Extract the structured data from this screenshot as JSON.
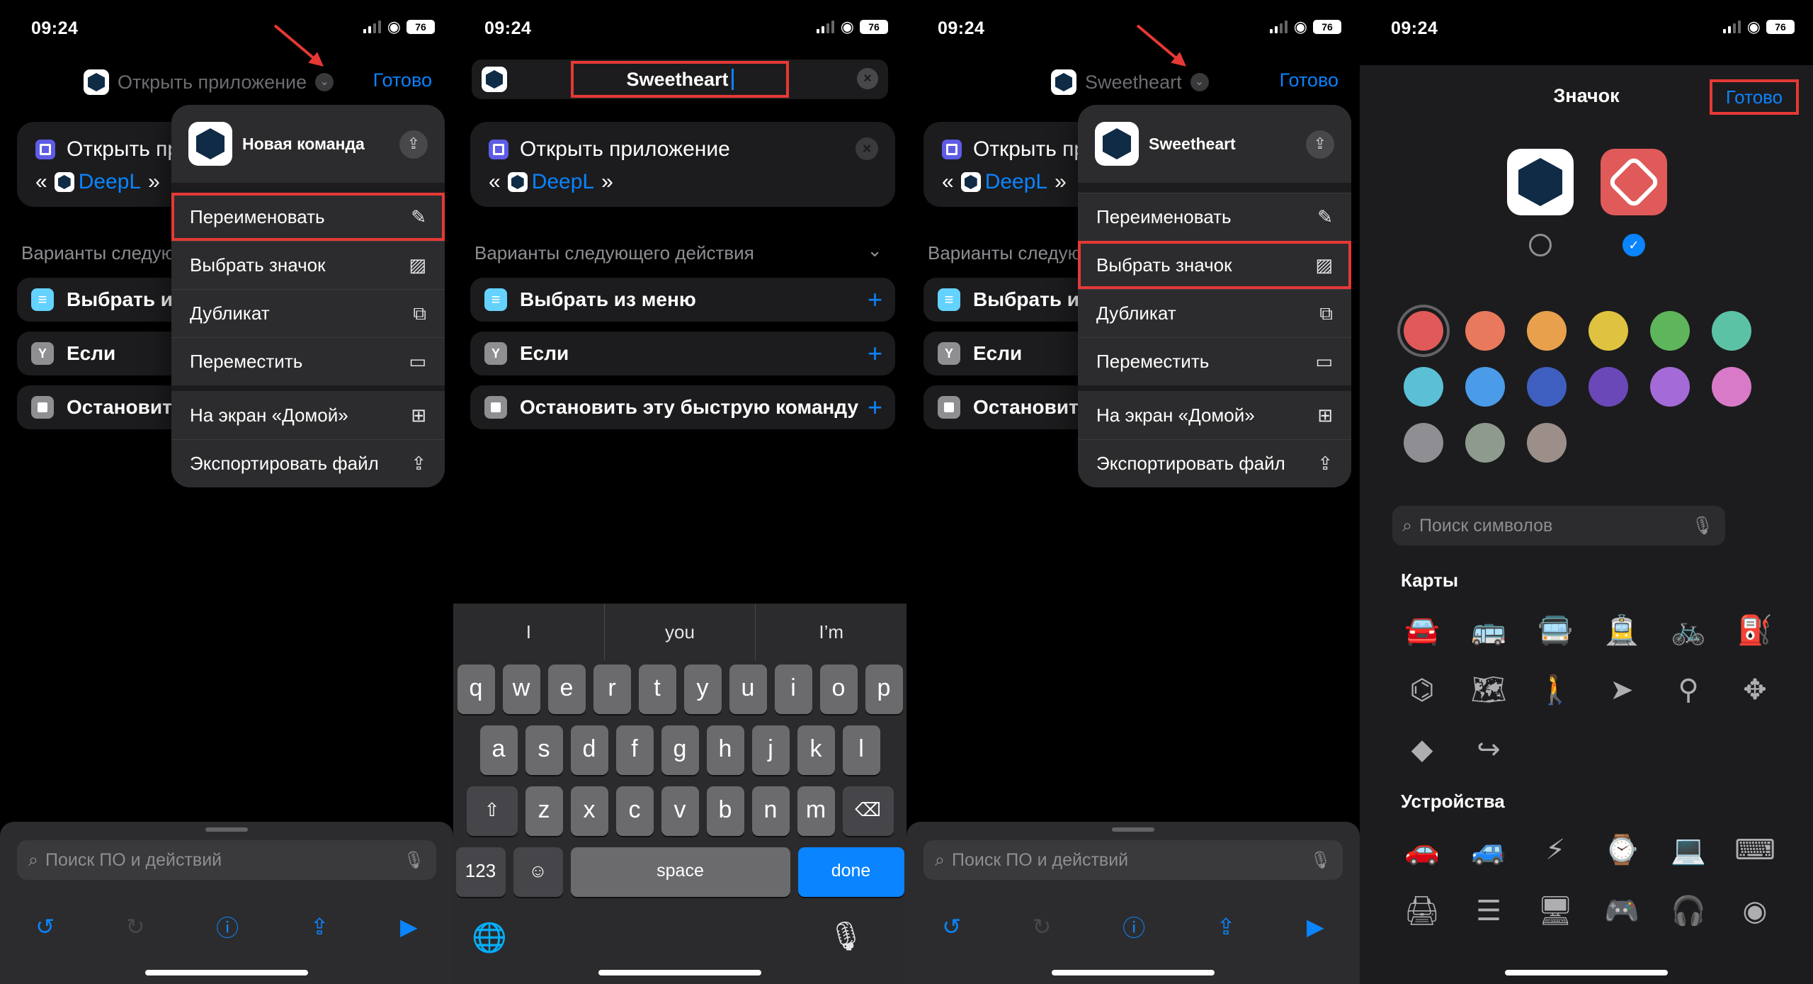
{
  "status": {
    "time": "09:24",
    "battery": "76"
  },
  "panel1": {
    "nav_title": "Открыть приложение",
    "done": "Готово",
    "action_title": "Открыть приложение",
    "action_quote_open": "«",
    "action_app": "DeepL",
    "action_quote_close": "»",
    "section_label": "Варианты следующего действия",
    "suggestions": [
      "Выбрать из меню",
      "Если",
      "Остановить эту быструю команду"
    ],
    "menu": {
      "title": "Новая команда",
      "items": [
        {
          "label": "Переименовать",
          "icon": "pencil-icon"
        },
        {
          "label": "Выбрать значок",
          "icon": "image-icon"
        },
        {
          "label": "Дубликат",
          "icon": "duplicate-icon"
        },
        {
          "label": "Переместить",
          "icon": "folder-icon"
        },
        {
          "label": "На экран «Домой»",
          "icon": "add-square-icon"
        },
        {
          "label": "Экспортировать файл",
          "icon": "share-icon"
        }
      ]
    },
    "search_placeholder": "Поиск ПО и действий"
  },
  "panel2": {
    "rename_value": "Sweetheart",
    "action_title": "Открыть приложение",
    "action_quote_open": "«",
    "action_app": "DeepL",
    "action_quote_close": "»",
    "section_label": "Варианты следующего действия",
    "suggestions": [
      "Выбрать из меню",
      "Если",
      "Остановить эту быструю команду"
    ],
    "keyboard": {
      "predictions": [
        "I",
        "you",
        "I’m"
      ],
      "row1": [
        "q",
        "w",
        "e",
        "r",
        "t",
        "y",
        "u",
        "i",
        "o",
        "p"
      ],
      "row2": [
        "a",
        "s",
        "d",
        "f",
        "g",
        "h",
        "j",
        "k",
        "l"
      ],
      "row3": [
        "z",
        "x",
        "c",
        "v",
        "b",
        "n",
        "m"
      ],
      "numbers_key": "123",
      "space_key": "space",
      "done_key": "done"
    }
  },
  "panel3": {
    "nav_title": "Sweetheart",
    "done": "Готово",
    "action_title": "Открыть приложение",
    "action_quote_open": "«",
    "action_app": "DeepL",
    "action_quote_close": "»",
    "section_label": "Варианты следующего действия",
    "suggestions": [
      "Выбрать из меню",
      "Если",
      "Остановить эту быструю команду"
    ],
    "menu": {
      "title": "Sweetheart",
      "items": [
        {
          "label": "Переименовать",
          "icon": "pencil-icon"
        },
        {
          "label": "Выбрать значок",
          "icon": "image-icon"
        },
        {
          "label": "Дубликат",
          "icon": "duplicate-icon"
        },
        {
          "label": "Переместить",
          "icon": "folder-icon"
        },
        {
          "label": "На экран «Домой»",
          "icon": "add-square-icon"
        },
        {
          "label": "Экспортировать файл",
          "icon": "share-icon"
        }
      ]
    },
    "search_placeholder": "Поиск ПО и действий"
  },
  "panel4": {
    "title": "Значок",
    "done": "Готово",
    "colors": [
      "#e05a5a",
      "#e8795c",
      "#e8a04c",
      "#dfc23f",
      "#5fb55b",
      "#5cc2a6",
      "#5bc0d6",
      "#4a9be8",
      "#3f5fc0",
      "#6a48b8",
      "#a46ad8",
      "#d87ac8",
      "#8e8e93",
      "#8f9a8f",
      "#9c8f8a"
    ],
    "symbol_search_placeholder": "Поиск символов",
    "cat_maps": "Карты",
    "cat_devices": "Устройства",
    "maps_symbols": [
      "car-icon",
      "bus-icon",
      "bus-front-icon",
      "tram-icon",
      "bicycle-icon",
      "fuel-icon",
      "binoculars-icon",
      "map-icon",
      "walking-icon",
      "location-arrow-icon",
      "pin-icon",
      "move-icon",
      "directions-icon",
      "turn-right-icon"
    ],
    "device_symbols": [
      "car-side-icon",
      "car-rear-icon",
      "ev-car-icon",
      "watch-icon",
      "laptop-icon",
      "keyboard-icon",
      "printer-icon",
      "server-icon",
      "display-icon",
      "gamepad-icon",
      "headphones-icon",
      "speaker-icon"
    ]
  }
}
